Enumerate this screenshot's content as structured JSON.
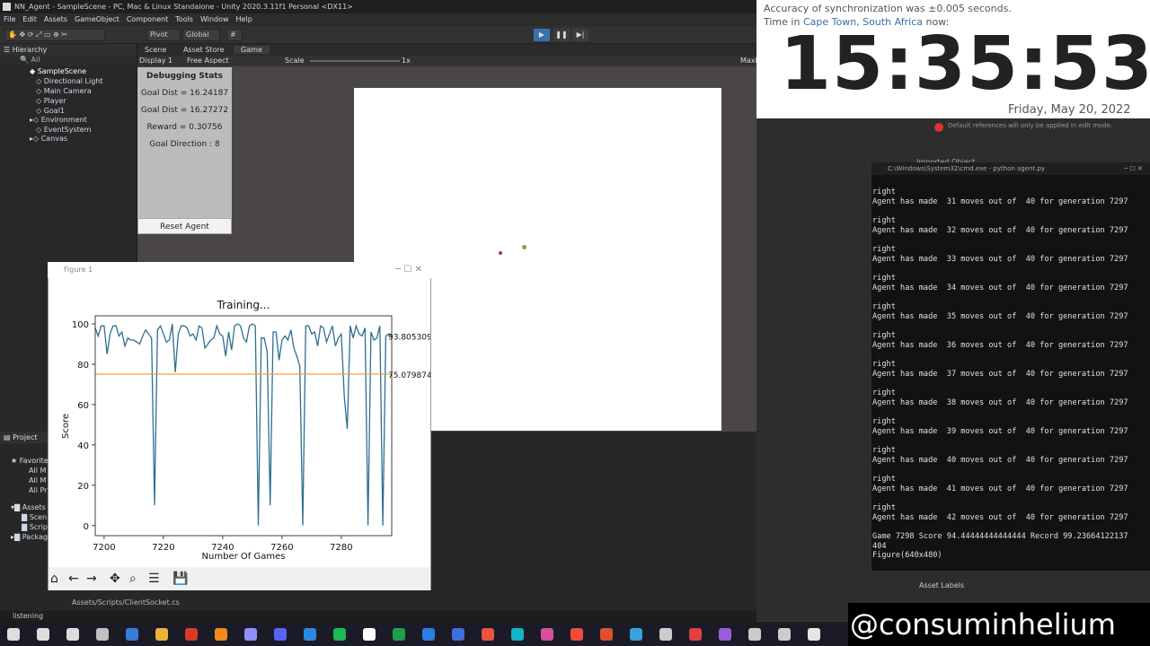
{
  "unity": {
    "title": "NN_Agent - SampleScene - PC, Mac & Linux Standalone - Unity 2020.3.11f1 Personal <DX11>",
    "menu": [
      "File",
      "Edit",
      "Assets",
      "GameObject",
      "Component",
      "Tools",
      "Window",
      "Help"
    ],
    "toolbar": {
      "pivot": "Pivot",
      "global": "Global"
    },
    "hierarchy": {
      "tab": "Hierarchy",
      "search": "All",
      "scene": "SampleScene",
      "items": [
        "Directional Light",
        "Main Camera",
        "Player",
        "Goal1",
        "Environment",
        "EventSystem",
        "Canvas"
      ]
    },
    "tabs": [
      "Scene",
      "Asset Store",
      "Game"
    ],
    "gamebar": {
      "display": "Display 1",
      "aspect": "Free Aspect",
      "scale_label": "Scale",
      "scale_value": "1x",
      "maximize": "Maxi"
    },
    "debug": {
      "title": "Debugging Stats",
      "goal_dist_1": "Goal Dist = 16.24187",
      "goal_dist_2": "Goal Dist = 16.27272",
      "reward": "Reward = 0.30756",
      "direction": "Goal Direction : 8",
      "reset": "Reset Agent"
    },
    "project": {
      "tab": "Project",
      "favorites": "Favorites",
      "fav_items": [
        "All M",
        "All M",
        "All Pr"
      ],
      "assets": "Assets",
      "asset_items": [
        "Scen",
        "Scrip"
      ],
      "packages": "Packag",
      "path": "Assets/Scripts/ClientSocket.cs"
    },
    "status": "listening",
    "inspector": {
      "warning": "Default references will only be applied in edit mode.",
      "imported": "Imported Object",
      "asset_labels": "Asset Labels"
    }
  },
  "clock": {
    "sync": "Accuracy of synchronization was ±0.005 seconds.",
    "time_prefix": "Time in ",
    "location": "Cape Town, South Africa",
    "time_suffix": " now:",
    "time": "15:35:53",
    "date": "Friday, May 20, 2022"
  },
  "cmd": {
    "title": "C:\\Windows\\System32\\cmd.exe - python  agent.py",
    "lines": [
      "right",
      "Agent has made  31 moves out of  40 for generation 7297",
      "",
      "right",
      "Agent has made  32 moves out of  40 for generation 7297",
      "",
      "right",
      "Agent has made  33 moves out of  40 for generation 7297",
      "",
      "right",
      "Agent has made  34 moves out of  40 for generation 7297",
      "",
      "right",
      "Agent has made  35 moves out of  40 for generation 7297",
      "",
      "right",
      "Agent has made  36 moves out of  40 for generation 7297",
      "",
      "right",
      "Agent has made  37 moves out of  40 for generation 7297",
      "",
      "right",
      "Agent has made  38 moves out of  40 for generation 7297",
      "",
      "right",
      "Agent has made  39 moves out of  40 for generation 7297",
      "",
      "right",
      "Agent has made  40 moves out of  40 for generation 7297",
      "",
      "right",
      "Agent has made  41 moves out of  40 for generation 7297",
      "",
      "right",
      "Agent has made  42 moves out of  40 for generation 7297",
      "",
      "Game 7298 Score 94.44444444444444 Record 99.23664122137",
      "404",
      "Figure(640x480)"
    ]
  },
  "figure": {
    "window_title": "Figure 1"
  },
  "chart_data": {
    "type": "line",
    "title": "Training...",
    "xlabel": "Number Of Games",
    "ylabel": "Score",
    "xlim": [
      7197,
      7297
    ],
    "ylim": [
      -5,
      104
    ],
    "xticks": [
      7200,
      7220,
      7240,
      7260,
      7280
    ],
    "yticks": [
      0,
      20,
      40,
      60,
      80,
      100
    ],
    "series": [
      {
        "color": "#2f6f8f",
        "x": [
          7197,
          7198,
          7199,
          7200,
          7201,
          7202,
          7203,
          7204,
          7205,
          7206,
          7207,
          7208,
          7209,
          7210,
          7211,
          7212,
          7213,
          7214,
          7215,
          7216,
          7217,
          7218,
          7219,
          7220,
          7221,
          7222,
          7223,
          7224,
          7225,
          7226,
          7227,
          7228,
          7229,
          7230,
          7231,
          7232,
          7233,
          7234,
          7235,
          7236,
          7237,
          7238,
          7239,
          7240,
          7241,
          7242,
          7243,
          7244,
          7245,
          7246,
          7247,
          7248,
          7249,
          7250,
          7251,
          7252,
          7253,
          7254,
          7255,
          7256,
          7257,
          7258,
          7259,
          7260,
          7261,
          7262,
          7263,
          7264,
          7265,
          7266,
          7267,
          7268,
          7269,
          7270,
          7271,
          7272,
          7273,
          7274,
          7275,
          7276,
          7277,
          7278,
          7279,
          7280,
          7281,
          7282,
          7283,
          7284,
          7285,
          7286,
          7287,
          7288,
          7289,
          7290,
          7291,
          7292,
          7293,
          7294,
          7295,
          7296,
          7297
        ],
        "values": [
          98,
          94,
          99,
          99,
          85,
          95,
          99,
          99,
          94,
          96,
          89,
          93,
          92,
          92,
          91,
          90,
          94,
          97,
          95,
          93,
          10,
          97,
          99,
          95,
          91,
          92,
          100,
          76,
          95,
          99,
          99,
          98,
          94,
          95,
          92,
          99,
          98,
          88,
          90,
          92,
          93,
          99,
          95,
          94,
          84,
          96,
          87,
          99,
          100,
          99,
          93,
          91,
          99,
          100,
          99,
          0,
          93,
          93,
          86,
          10,
          96,
          96,
          82,
          92,
          94,
          92,
          97,
          88,
          84,
          79,
          0,
          99,
          99,
          95,
          96,
          89,
          99,
          98,
          91,
          95,
          99,
          89,
          93,
          95,
          64,
          48,
          99,
          93,
          99,
          95,
          94,
          98,
          0,
          96,
          92,
          93,
          99,
          0,
          94,
          95,
          94
        ]
      },
      {
        "name": "",
        "color": "#f0a23e",
        "x": [
          7197,
          7297
        ],
        "values": [
          75.079874,
          75.079874
        ]
      }
    ],
    "annotations": [
      "93.805309",
      "75.079874"
    ]
  },
  "handle": "@consuminhelium"
}
